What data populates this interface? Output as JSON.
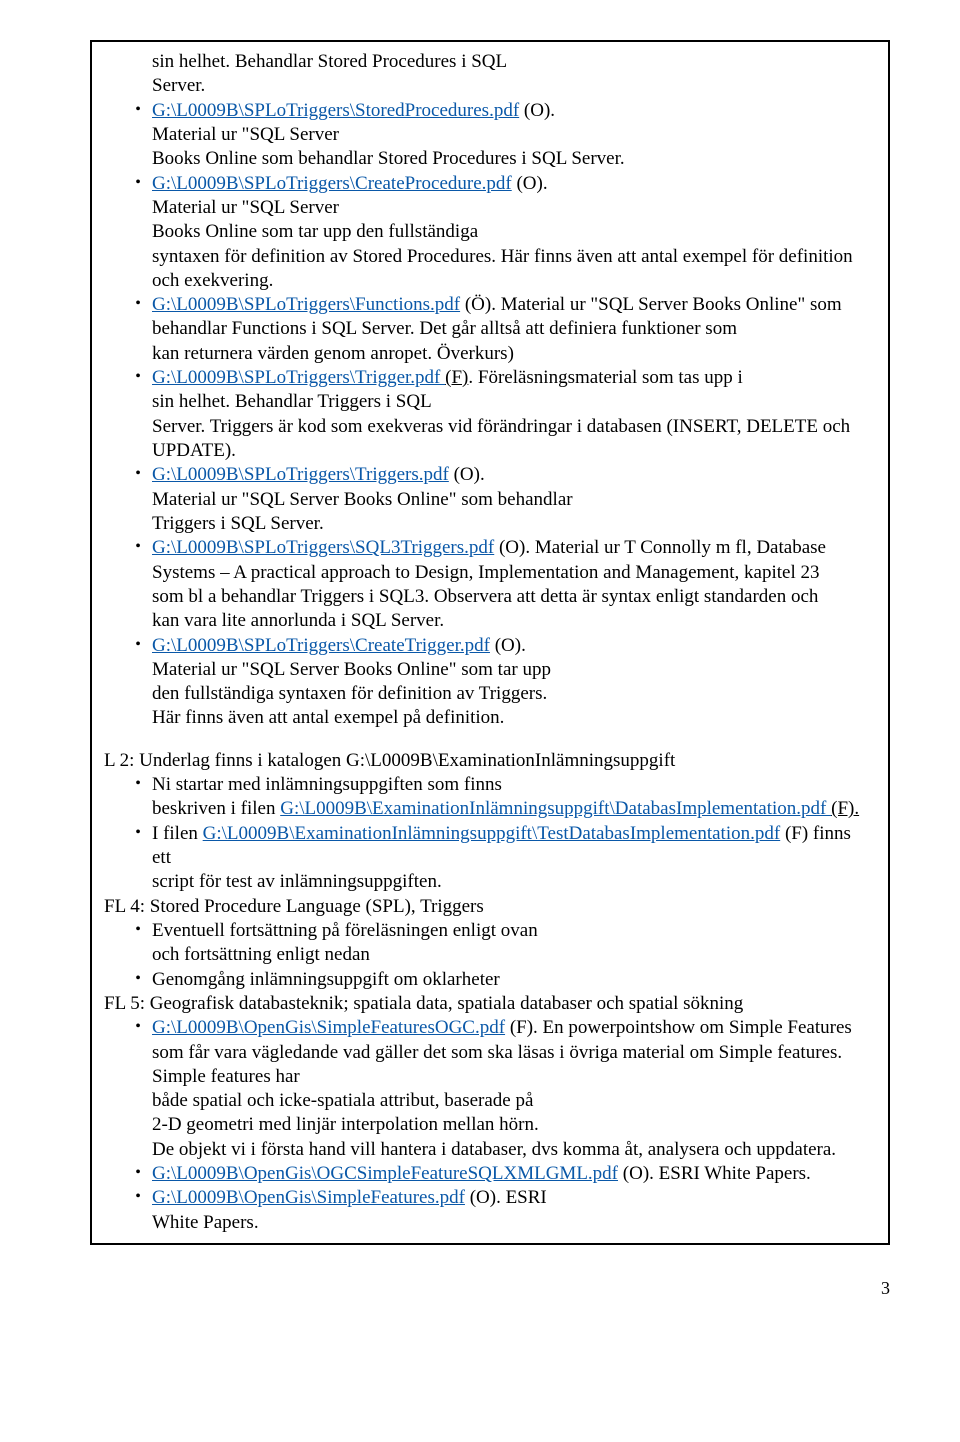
{
  "intro": {
    "line1": "sin helhet. Behandlar Stored Procedures i SQL",
    "line2": "Server."
  },
  "items": [
    {
      "link": "G:\\L0009B\\SPLoTriggers\\StoredProcedures.pdf",
      "suffix": " (O).",
      "tail": "Material ur \"SQL Server\nBooks Online som behandlar Stored Procedures i SQL Server."
    },
    {
      "link": "G:\\L0009B\\SPLoTriggers\\CreateProcedure.pdf",
      "suffix": " (O).",
      "tail": "Material ur \"SQL Server\nBooks Online som tar upp den fullständiga\nsyntaxen för definition av Stored Procedures. Här finns även att antal exempel för definition\noch exekvering."
    },
    {
      "link": "G:\\L0009B\\SPLoTriggers\\Functions.pdf",
      "suffix": " (Ö). Material ur \"SQL Server Books Online\" som",
      "tail": "behandlar Functions i SQL Server. Det går alltså att definiera funktioner som\nkan returnera värden genom anropet. Överkurs)"
    },
    {
      "link": "G:\\L0009B\\SPLoTriggers\\Trigger.pdf ",
      "suffix": "(F)",
      "post": ". Föreläsningsmaterial som tas upp i",
      "tail": "sin helhet. Behandlar Triggers i SQL\nServer. Triggers är kod som exekveras vid förändringar i databasen (INSERT, DELETE och\nUPDATE).",
      "underlineSuffix": true
    },
    {
      "link": "G:\\L0009B\\SPLoTriggers\\Triggers.pdf",
      "suffix": " (O).",
      "tail": "Material ur \"SQL Server Books Online\" som behandlar\nTriggers i SQL Server."
    },
    {
      "link": "G:\\L0009B\\SPLoTriggers\\SQL3Triggers.pdf",
      "suffix": " (O). Material ur T Connolly m fl, Database",
      "tail": "Systems – A practical approach to Design, Implementation and Management, kapitel 23\nsom bl a behandlar Triggers i SQL3. Observera att detta är syntax enligt standarden och\nkan vara lite annorlunda i SQL Server."
    },
    {
      "link": "G:\\L0009B\\SPLoTriggers\\CreateTrigger.pdf",
      "suffix": " (O).",
      "tail": "Material ur \"SQL Server Books Online\" som tar upp\nden fullständiga syntaxen för definition av Triggers.\nHär finns även att antal exempel på definition."
    }
  ],
  "l2": {
    "heading": "L 2: Underlag finns i katalogen G:\\L0009B\\ExaminationInlämningsuppgift",
    "items": [
      {
        "pre": "Ni startar med inlämningsuppgiften som finns\nbeskriven i filen ",
        "link": "G:\\L0009B\\ExaminationInlämningsuppgift\\DatabasImplementation.pdf ",
        "suffix": "(F).",
        "underlineSuffix": true
      },
      {
        "pre": "I filen ",
        "link": "G:\\L0009B\\ExaminationInlämningsuppgift\\TestDatabasImplementation.pdf",
        "suffix": " (F) finns",
        "tail": "ett\nscript för test av inlämningsuppgiften."
      }
    ]
  },
  "fl4": {
    "heading": "FL 4: Stored Procedure Language (SPL), Triggers",
    "items": [
      {
        "text": "Eventuell fortsättning på föreläsningen enligt ovan\noch fortsättning enligt nedan"
      },
      {
        "text": "Genomgång inlämningsuppgift om oklarheter"
      }
    ]
  },
  "fl5": {
    "heading": "FL 5: Geografisk databasteknik; spatiala data, spatiala databaser och spatial sökning",
    "items": [
      {
        "link": "G:\\L0009B\\OpenGis\\SimpleFeaturesOGC.pdf",
        "suffix": " (F). En powerpointshow om Simple Features",
        "tail": "som får vara vägledande vad gäller det som ska läsas i övriga material om Simple features.\nSimple features har\nbåde spatial och icke-spatiala attribut, baserade på\n2-D geometri med linjär interpolation mellan hörn.\nDe objekt vi i första hand vill hantera i databaser, dvs komma åt, analysera och uppdatera."
      },
      {
        "link": "G:\\L0009B\\OpenGis\\OGCSimpleFeatureSQLXMLGML.pdf",
        "suffix": " (O).  ESRI White Papers."
      },
      {
        "link": "G:\\L0009B\\OpenGis\\SimpleFeatures.pdf",
        "suffix": " (O). ESRI",
        "tail": "White Papers."
      }
    ]
  },
  "pageno": "3"
}
